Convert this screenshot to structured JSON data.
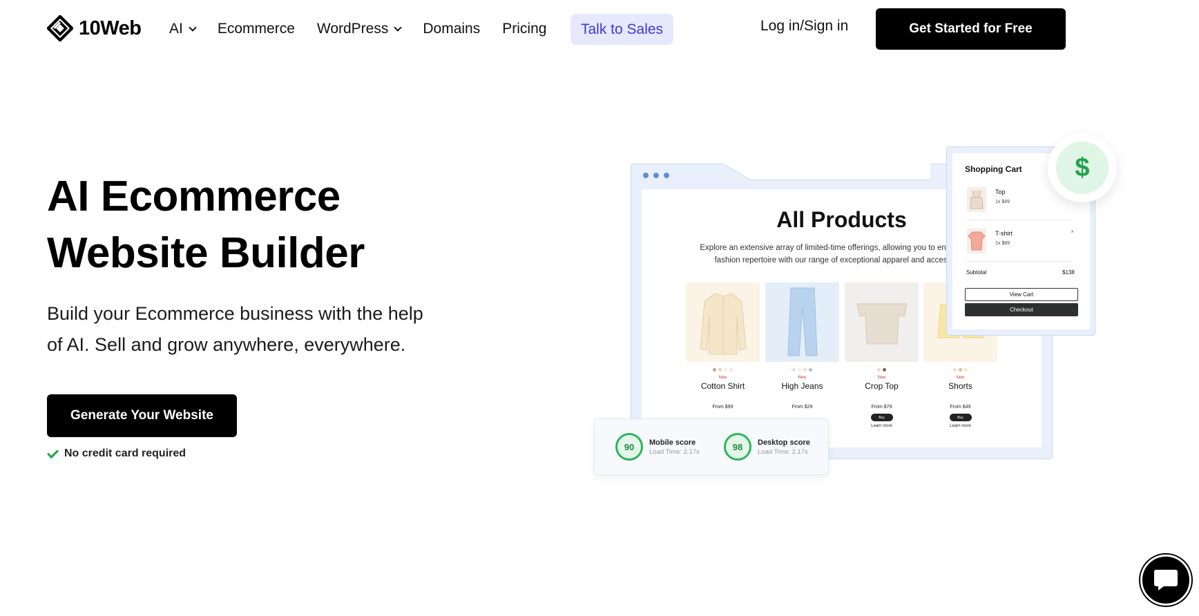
{
  "brand": {
    "name": "10Web"
  },
  "nav": {
    "items": [
      {
        "label": "AI",
        "has_dropdown": true
      },
      {
        "label": "Ecommerce",
        "has_dropdown": false
      },
      {
        "label": "WordPress",
        "has_dropdown": true
      },
      {
        "label": "Domains",
        "has_dropdown": false
      },
      {
        "label": "Pricing",
        "has_dropdown": false
      }
    ],
    "talk_sales": "Talk to Sales",
    "login": "Log in/Sign in",
    "cta": "Get Started for Free"
  },
  "hero": {
    "title_line1": "AI Ecommerce",
    "title_line2": "Website Builder",
    "subtitle_line1": "Build your Ecommerce business with the help",
    "subtitle_line2": "of AI. Sell and grow anywhere, everywhere.",
    "cta": "Generate Your Website",
    "note": "No credit card required"
  },
  "mockup": {
    "heading": "All Products",
    "description_line1": "Explore an extensive array of limited-time offerings, allowing you to enhance your",
    "description_line2": "fashion repertoire with our range of exceptional apparel and accessories.",
    "products": [
      {
        "badge": "New",
        "name": "Cotton Shirt",
        "price": "From $99",
        "buy": "",
        "learn": ""
      },
      {
        "badge": "New",
        "name": "High Jeans",
        "price": "From $29",
        "buy": "",
        "learn": ""
      },
      {
        "badge": "New",
        "name": "Crop Top",
        "price": "From $79",
        "buy": "Buy",
        "learn": "Learn more"
      },
      {
        "badge": "New",
        "name": "Shorts",
        "price": "From $49",
        "buy": "Buy",
        "learn": "Learn more"
      }
    ],
    "cart": {
      "title": "Shopping Cart",
      "items": [
        {
          "name": "Top",
          "qty": "1x $49",
          "remove": ""
        },
        {
          "name": "T-shirt",
          "qty": "1x $89",
          "remove": "×"
        }
      ],
      "subtotal_label": "Subtotal",
      "subtotal_value": "$138",
      "view_cart": "View Cart",
      "checkout": "Checkout",
      "currency_symbol": "$"
    },
    "scores": [
      {
        "value": "90",
        "label": "Mobile score",
        "time": "Load Time: 2.17s"
      },
      {
        "value": "98",
        "label": "Desktop score",
        "time": "Load Time: 2.17s"
      }
    ]
  },
  "colors": {
    "primary": "#000000",
    "accent_blue": "#3b39d6",
    "accent_blue_bg": "#e6e8fd",
    "success": "#1fa34c",
    "mockup_bg": "#e9f0fb"
  },
  "icons": [
    "logo-icon",
    "chevron-down-icon",
    "check-icon",
    "dollar-icon",
    "chat-icon"
  ]
}
